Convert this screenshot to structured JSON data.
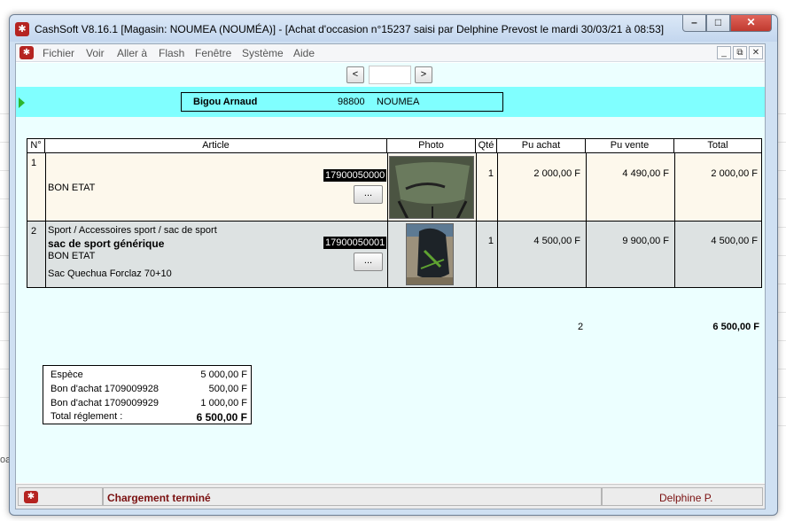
{
  "window": {
    "title": "CashSoft V8.16.1 [Magasin: NOUMEA (NOUMÉA)] - [Achat d'occasion n°15237 saisi par Delphine Prevost le mardi 30/03/21 à 08:53]",
    "minimize": "–",
    "maximize": "□",
    "close": "✕"
  },
  "menu": {
    "items": [
      "Fichier",
      "Voir",
      "Aller à",
      "Flash",
      "Fenêtre",
      "Système",
      "Aide"
    ],
    "mdi_min": "_",
    "mdi_restore": "⧉",
    "mdi_close": "✕"
  },
  "nav": {
    "prev": "<",
    "next": ">",
    "value": ""
  },
  "client": {
    "name": "Bigou Arnaud",
    "zip": "98800",
    "city": "NOUMEA"
  },
  "table": {
    "headers": [
      "N°",
      "Article",
      "Photo",
      "Qté",
      "Pu achat",
      "Pu vente",
      "Total"
    ],
    "rows": [
      {
        "num": "1",
        "category": "",
        "name": "",
        "condition": "BON ETAT",
        "description": "",
        "barcode": "17900050000",
        "button": "...",
        "qty": "1",
        "pu_achat": "2 000,00 F",
        "pu_vente": "4 490,00 F",
        "total": "2 000,00 F",
        "photo_icon": "chair-photo",
        "bg": "#fdf8ec"
      },
      {
        "num": "2",
        "category": "Sport / Accessoires sport / sac de sport",
        "name": "sac de sport générique",
        "condition": "BON ETAT",
        "description": "Sac Quechua Forclaz 70+10",
        "barcode": "17900050001",
        "button": "...",
        "qty": "1",
        "pu_achat": "4 500,00 F",
        "pu_vente": "9 900,00 F",
        "total": "4 500,00 F",
        "photo_icon": "backpack-photo",
        "bg": "#dde2e2"
      }
    ],
    "total_qty": "2",
    "total_amount": "6 500,00 F"
  },
  "payment": {
    "rows": [
      {
        "label": "Espèce",
        "value": "5 000,00 F"
      },
      {
        "label": "Bon d'achat 1709009928",
        "value": "500,00 F"
      },
      {
        "label": "Bon d'achat 1709009929",
        "value": "1 000,00 F"
      }
    ],
    "total_label": "Total réglement :",
    "total_value": "6 500,00 F"
  },
  "status": {
    "message": "Chargement terminé",
    "user": "Delphine P."
  },
  "background": {
    "snippet": "oa"
  },
  "colors": {
    "band": "#80ffff",
    "content": "#ecffff",
    "status_text": "#7a1010",
    "brand": "#b52421"
  }
}
